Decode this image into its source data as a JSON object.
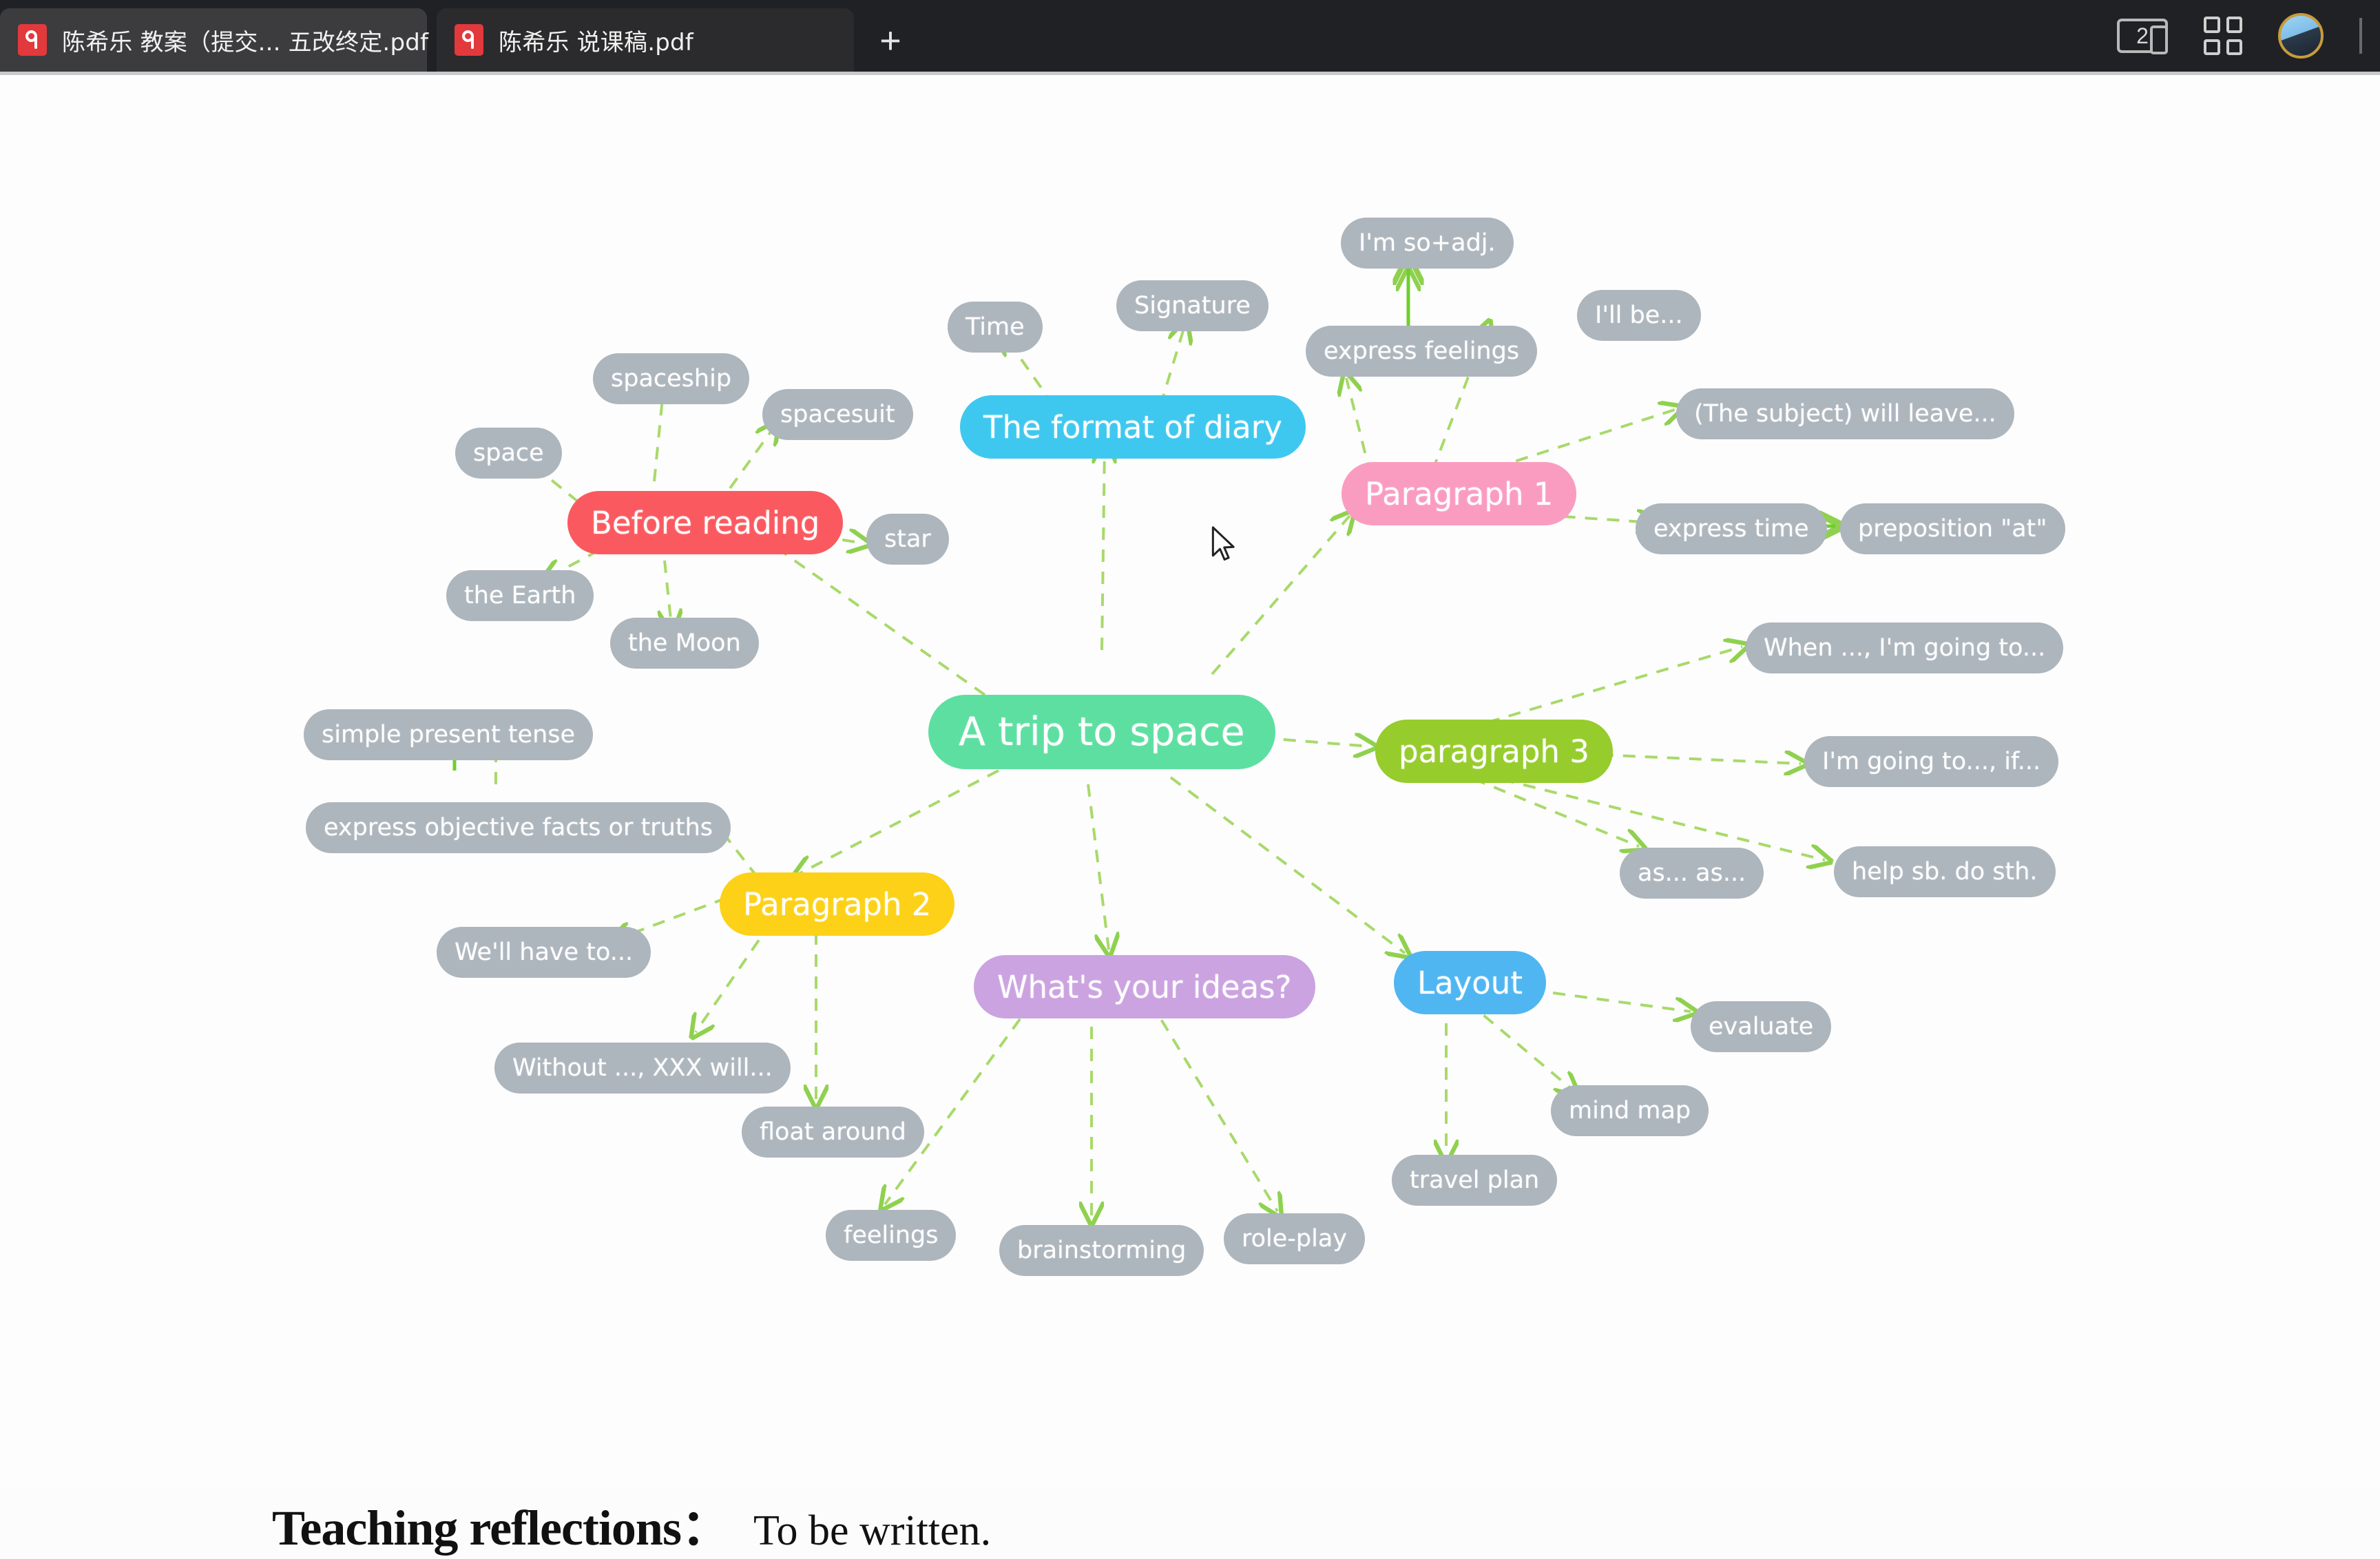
{
  "browser": {
    "tabs": [
      {
        "title": "陈希乐 教案（提交... 五改终定.pdf",
        "close_label": "✕",
        "favicon": "pdf-icon",
        "active": true
      },
      {
        "title": "陈希乐 说课稿.pdf",
        "close_label": "",
        "favicon": "pdf-icon",
        "active": false
      }
    ],
    "new_tab_label": "+",
    "tab_count": "2",
    "grid_button_name": "tab-grid-icon",
    "avatar_name": "user-avatar"
  },
  "mindmap": {
    "root": {
      "label": "A trip to space",
      "color": "#5ddfa1"
    },
    "branches": [
      {
        "label": "Before reading",
        "color": "#fa5a5f",
        "children": [
          "space",
          "spaceship",
          "spacesuit",
          "star",
          "the Earth",
          "the Moon"
        ]
      },
      {
        "label": "The format of diary",
        "color": "#3ec8ef",
        "children": [
          "Time",
          "Signature"
        ]
      },
      {
        "label": "Paragraph 1",
        "color": "#fa9cc0",
        "children": [
          "express feelings",
          "I'm so+adj.",
          "I'll be...",
          "(The subject) will leave...",
          "express time",
          "preposition \"at\""
        ]
      },
      {
        "label": "paragraph 3",
        "color": "#96cc2c",
        "children": [
          "When ..., I'm going to...",
          "I'm going to..., if...",
          "as... as...",
          "help sb. do sth."
        ]
      },
      {
        "label": "Paragraph 2",
        "color": "#fdd117",
        "children": [
          "simple present tense",
          "express objective facts or truths",
          "We'll have to...",
          "Without ..., XXX will...",
          "float around"
        ]
      },
      {
        "label": "What's your ideas?",
        "color": "#cba3e0",
        "children": [
          "feelings",
          "brainstorming",
          "role-play"
        ]
      },
      {
        "label": "Layout",
        "color": "#4fb6f2",
        "children": [
          "evaluate",
          "mind map",
          "travel plan"
        ]
      }
    ],
    "sub_node_color": "#adb5bd",
    "edge_color": "#8fd14f"
  },
  "nodes": {
    "root": "A trip to space",
    "space": "space",
    "spaceship": "spaceship",
    "spacesuit": "spacesuit",
    "star": "star",
    "the_earth": "the Earth",
    "the_moon": "the Moon",
    "before_reading": "Before reading",
    "time": "Time",
    "signature": "Signature",
    "format_of_diary": "The format of diary",
    "im_so_adj": "I'm so+adj.",
    "express_feelings": "express feelings",
    "ill_be": "I'll be...",
    "subject_will_leave": "(The subject) will leave...",
    "paragraph_1": "Paragraph 1",
    "express_time": "express time",
    "preposition_at": "preposition \"at\"",
    "when_im_going_to": "When ..., I'm going to...",
    "im_going_to_if": "I'm going to..., if...",
    "as_as": "as... as...",
    "help_sb_do_sth": "help sb. do sth.",
    "paragraph_3": "paragraph 3",
    "simple_present_tense": "simple present tense",
    "express_objective": "express objective facts or truths",
    "well_have_to": "We'll have to...",
    "without_xxx_will": "Without ..., XXX will...",
    "float_around": "float around",
    "paragraph_2": "Paragraph 2",
    "whats_your_ideas": "What's your ideas?",
    "feelings": "feelings",
    "brainstorming": "brainstorming",
    "role_play": "role-play",
    "layout": "Layout",
    "evaluate": "evaluate",
    "mind_map": "mind map",
    "travel_plan": "travel plan"
  },
  "footer": {
    "reflections_label": "Teaching reflections：",
    "reflections_value": "To be written."
  }
}
